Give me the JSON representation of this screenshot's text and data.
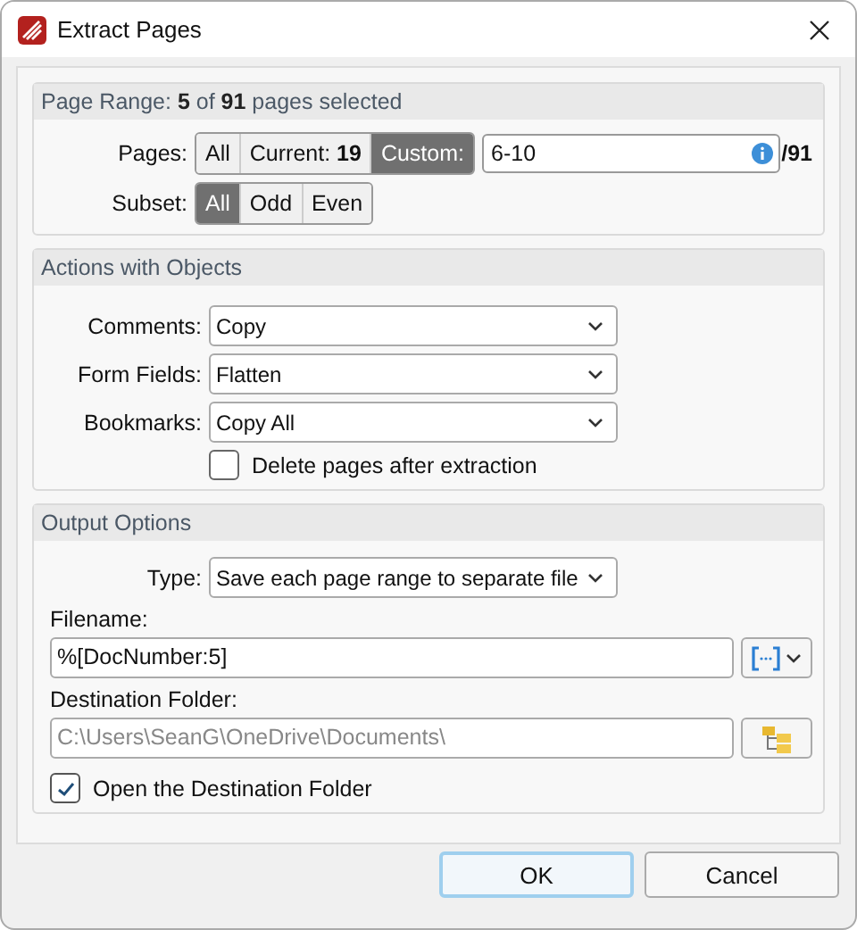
{
  "window": {
    "title": "Extract Pages"
  },
  "page_range": {
    "title": "Page Range: **5** of **91** pages selected",
    "pages_label": "Pages:",
    "page_options": [
      {
        "label": "All",
        "selected": false
      },
      {
        "label": "Current: **19**",
        "selected": false
      },
      {
        "label": "Custom:",
        "selected": true
      }
    ],
    "custom_value": "6-10",
    "total": "/91",
    "subset_label": "Subset:",
    "subset_options": [
      {
        "label": "All",
        "selected": true
      },
      {
        "label": "Odd",
        "selected": false
      },
      {
        "label": "Even",
        "selected": false
      }
    ]
  },
  "actions": {
    "title": "Actions with Objects",
    "dropdowns": [
      {
        "label": "Comments:",
        "value": "Copy"
      },
      {
        "label": "Form Fields:",
        "value": "Flatten"
      },
      {
        "label": "Bookmarks:",
        "value": "Copy All"
      }
    ],
    "delete_pages": {
      "label": "Delete pages after extraction",
      "checked": false
    }
  },
  "output": {
    "title": "Output Options",
    "type_label": "Type:",
    "type_value": "Save each page range to separate file",
    "filename_label": "Filename:",
    "filename_value": "%[DocNumber:5]",
    "folder_label": "Destination Folder:",
    "folder_value": "C:\\Users\\SeanG\\OneDrive\\Documents\\",
    "folder_disabled": true,
    "open_folder": {
      "label": "Open the Destination Folder",
      "checked": true
    }
  },
  "buttons": [
    {
      "label": "OK",
      "default": true
    },
    {
      "label": "Cancel",
      "default": false
    }
  ]
}
